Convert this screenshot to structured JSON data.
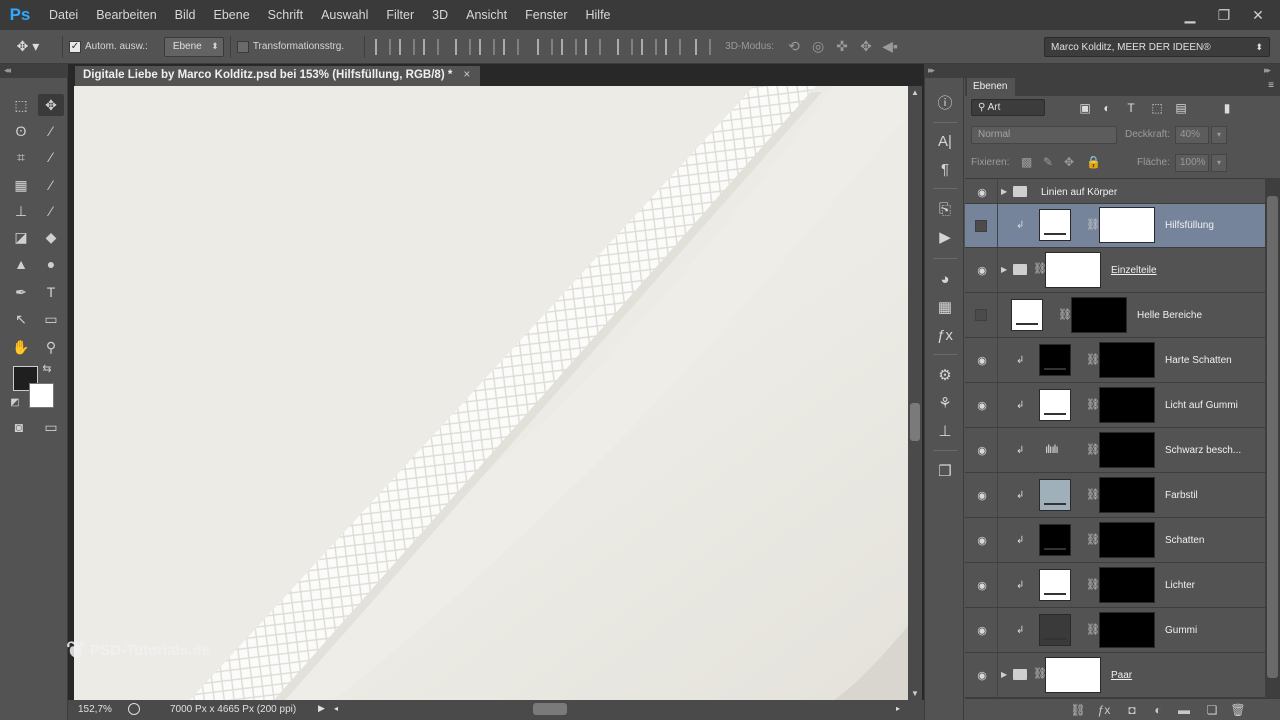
{
  "app": {
    "logo": "Ps"
  },
  "menu": [
    "Datei",
    "Bearbeiten",
    "Bild",
    "Ebene",
    "Schrift",
    "Auswahl",
    "Filter",
    "3D",
    "Ansicht",
    "Fenster",
    "Hilfe"
  ],
  "window_controls": {
    "minimize": "▁",
    "maximize": "❐",
    "close": "✕"
  },
  "options_bar": {
    "auto_select_label": "Autom. ausw.:",
    "auto_select_checked": true,
    "auto_select_target": "Ebene",
    "transform_label": "Transformationsstrg.",
    "transform_checked": false,
    "mode_3d_label": "3D-Modus:",
    "workspace": "Marco Kolditz, MEER DER IDEEN®"
  },
  "document": {
    "tab_title": "Digitale Liebe by Marco Kolditz.psd bei 153% (Hilfsfüllung, RGB/8) *",
    "tab_close": "×",
    "zoom": "152,7%",
    "info": "7000 Px x 4665 Px (200 ppi)",
    "watermark": "PSD-Tutorials.de",
    "colors": {
      "canvas_bg": "#ebeae4",
      "cord": "#fafaf8",
      "cord_shadow": "#c9c6bf"
    }
  },
  "colors": {
    "foreground": "#1f1f1f",
    "background": "#ffffff",
    "selection": "#75849a",
    "app_bg": "#535353"
  },
  "layers_panel": {
    "tab_label": "Ebenen",
    "filter_kind": "Art",
    "blend_mode": "Normal",
    "opacity_label": "Deckkraft:",
    "opacity_value": "40%",
    "lock_label": "Fixieren:",
    "fill_label": "Fläche:",
    "fill_value": "100%",
    "layers": [
      {
        "name": "Linien auf Körper",
        "type": "group",
        "visible": true,
        "selected": false
      },
      {
        "name": "Hilfsfüllung",
        "type": "adjust",
        "visible": false,
        "selected": true,
        "clipped": true,
        "mask": "white"
      },
      {
        "name": "Einzelteile",
        "type": "group-mask",
        "visible": true,
        "selected": false
      },
      {
        "name": "Helle Bereiche",
        "type": "adjust",
        "visible": false,
        "selected": false,
        "clipped": false,
        "mask": "black"
      },
      {
        "name": "Harte Schatten",
        "type": "adjust",
        "visible": true,
        "selected": false,
        "clipped": true,
        "mask": "black",
        "thumb": "#000000"
      },
      {
        "name": "Licht auf Gummi",
        "type": "adjust",
        "visible": true,
        "selected": false,
        "clipped": true,
        "mask": "black"
      },
      {
        "name": "Schwarz besch...",
        "type": "levels",
        "visible": true,
        "selected": false,
        "clipped": true,
        "mask": "black"
      },
      {
        "name": "Farbstil",
        "type": "adjust",
        "visible": true,
        "selected": false,
        "clipped": true,
        "mask": "black",
        "thumb": "#9fb0ba"
      },
      {
        "name": "Schatten",
        "type": "adjust",
        "visible": true,
        "selected": false,
        "clipped": true,
        "mask": "black",
        "thumb": "#000000"
      },
      {
        "name": "Lichter",
        "type": "adjust",
        "visible": true,
        "selected": false,
        "clipped": true,
        "mask": "black"
      },
      {
        "name": "Gummi",
        "type": "adjust",
        "visible": true,
        "selected": false,
        "clipped": true,
        "mask": "black",
        "thumb": "#2a2a2a"
      },
      {
        "name": "Paar",
        "type": "group-mask",
        "visible": true,
        "selected": false
      }
    ]
  }
}
